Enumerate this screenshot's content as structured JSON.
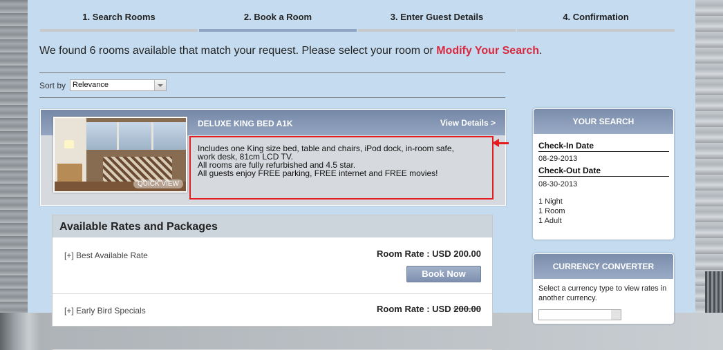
{
  "steps": [
    {
      "label": "1.  Search Rooms"
    },
    {
      "label": "2.  Book a Room"
    },
    {
      "label": "3.  Enter Guest Details"
    },
    {
      "label": "4.  Confirmation"
    }
  ],
  "results": {
    "found_text": "We found 6 rooms available that match your request. Please select your room or ",
    "modify_link": "Modify Your Search",
    "period": "."
  },
  "sort": {
    "label": "Sort by",
    "value": "Relevance"
  },
  "room": {
    "title": "DELUXE KING BED A1K",
    "view_details": "View Details >",
    "quick_view": "QUICK VIEW",
    "description": [
      "Includes one King size bed, table and chairs, iPod dock, in-room safe,",
      "work desk, 81cm LCD TV.",
      "All rooms are fully refurbished and 4.5 star.",
      "All guests enjoy FREE parking, FREE internet and FREE movies!"
    ]
  },
  "rates": {
    "title": "Available Rates and Packages",
    "items": [
      {
        "name": "[+] Best Available Rate",
        "price_label": "Room Rate : USD ",
        "price": "200.00",
        "book": "Book Now"
      },
      {
        "name": "[+] Early Bird Specials",
        "price_label": "Room Rate : USD ",
        "price": "200.00"
      }
    ]
  },
  "your_search": {
    "title": "YOUR SEARCH",
    "checkin_label": "Check-In Date",
    "checkin": "08-29-2013",
    "checkout_label": "Check-Out Date",
    "checkout": "08-30-2013",
    "night": "1  Night",
    "room": "1  Room",
    "adult": "1  Adult"
  },
  "currency": {
    "title": "CURRENCY CONVERTER",
    "text": "Select a currency type to view rates in another currency."
  },
  "colors": {
    "accent_red": "#d8283e",
    "header_blue": "#7588a7",
    "page_bg": "#c5dcf0"
  }
}
